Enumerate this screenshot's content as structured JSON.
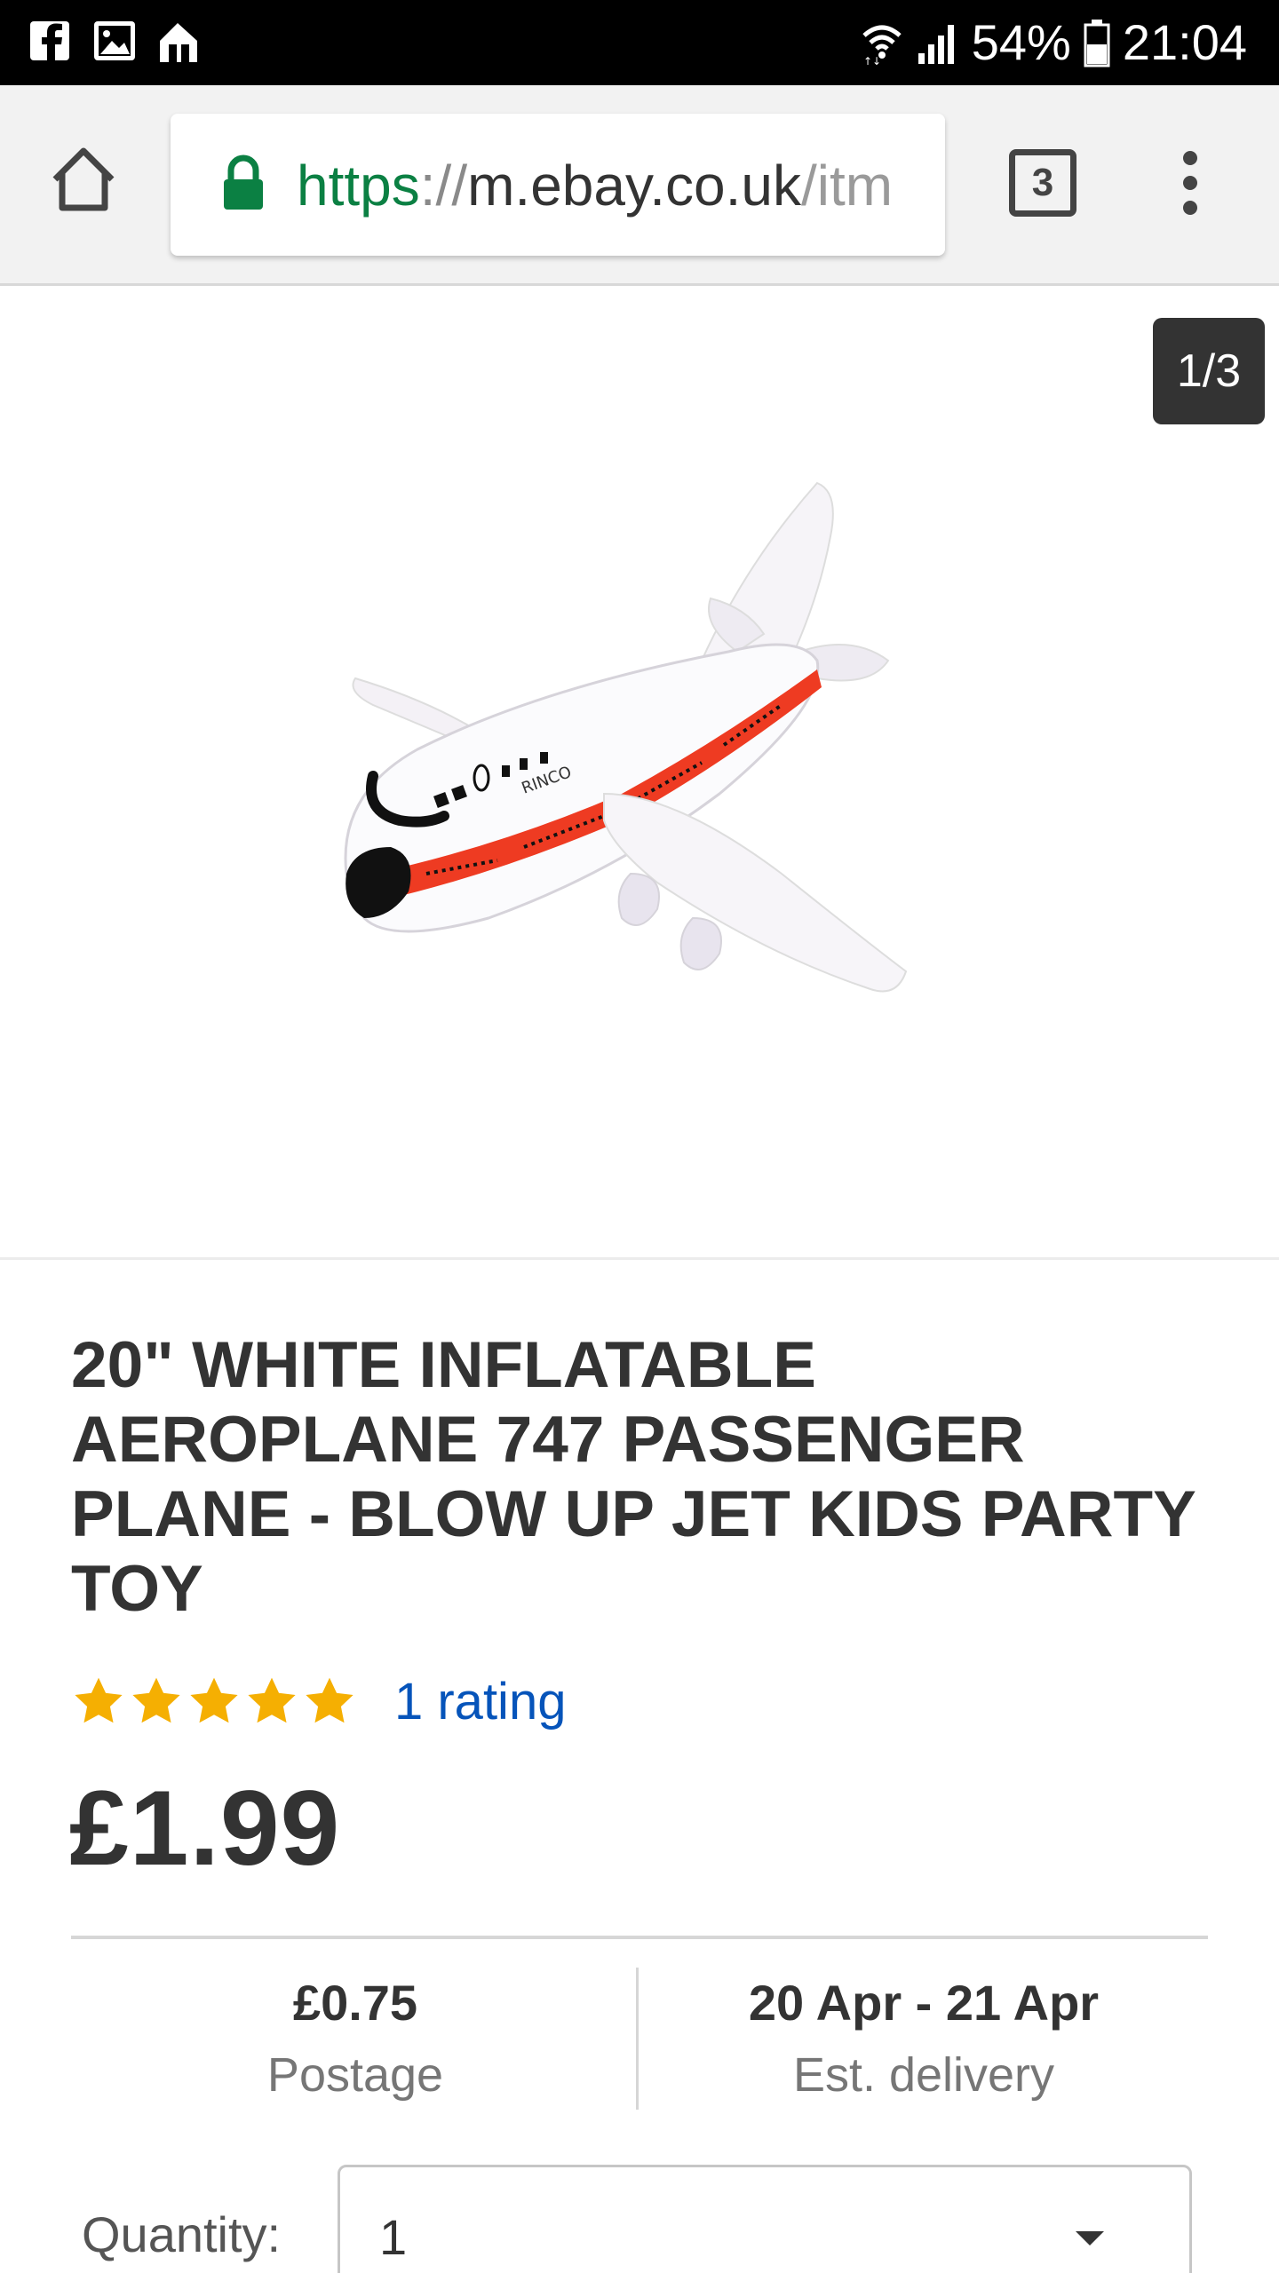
{
  "status_bar": {
    "battery": "54%",
    "time": "21:04",
    "left_icons": [
      "facebook-icon",
      "gallery-icon",
      "home-app-icon"
    ],
    "right_icons": [
      "wifi-icon",
      "signal-icon",
      "battery-icon"
    ]
  },
  "browser": {
    "url_scheme": "https",
    "url_separator": "://",
    "url_host": "m.ebay.co.uk",
    "url_path": "/itm",
    "tab_count": "3",
    "icons": [
      "home-icon",
      "lock-icon",
      "tabs-icon",
      "more-vert-icon"
    ]
  },
  "gallery": {
    "counter": "1/3",
    "image_alt": "inflatable aeroplane"
  },
  "product": {
    "title": "20\" WHITE INFLATABLE AEROPLANE 747 PASSENGER PLANE - BLOW UP JET KIDS PARTY TOY",
    "stars": 5,
    "rating_text": "1 rating",
    "price": "£1.99"
  },
  "shipping": {
    "postage_value": "£0.75",
    "postage_label": "Postage",
    "delivery_value": "20 Apr - 21 Apr",
    "delivery_label": "Est. delivery"
  },
  "quantity": {
    "label": "Quantity:",
    "value": "1"
  },
  "colors": {
    "link": "#0654ba",
    "star": "#f5af02",
    "secure_green": "#0b8043"
  }
}
